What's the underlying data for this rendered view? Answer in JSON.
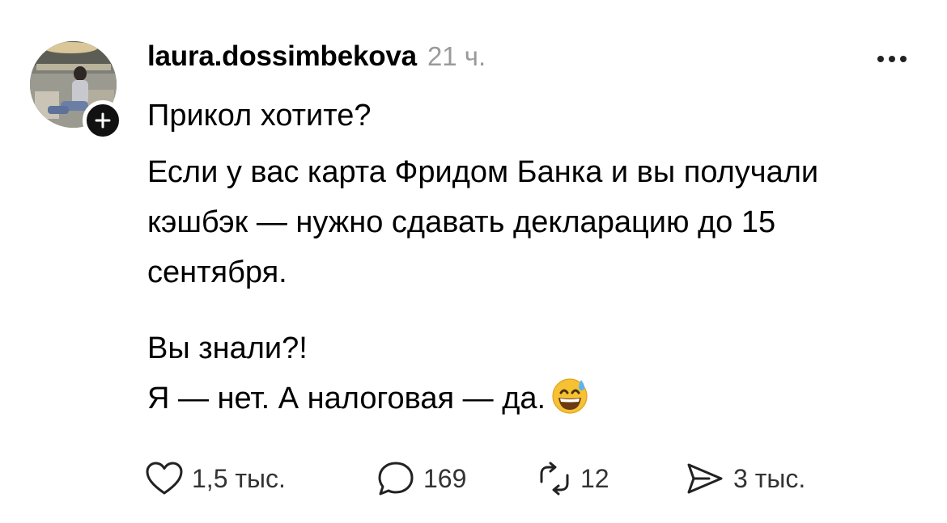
{
  "post": {
    "username": "laura.dossimbekova",
    "timestamp": "21 ч.",
    "paragraphs": [
      "Прикол хотите?",
      "Если у вас карта Фридом Банка и вы получали кэшбэк — нужно сдавать декларацию до 15 сентября.",
      "Вы знали?!",
      "Я — нет. А налоговая — да."
    ],
    "emoji": "grinning-face-with-sweat"
  },
  "actions": {
    "likes": "1,5 тыс.",
    "replies": "169",
    "reposts": "12",
    "shares": "3 тыс."
  },
  "icons": {
    "follow": "plus-icon",
    "more": "more-horizontal-icon",
    "like": "heart-icon",
    "reply": "speech-bubble-icon",
    "repost": "repost-icon",
    "share": "send-icon"
  }
}
